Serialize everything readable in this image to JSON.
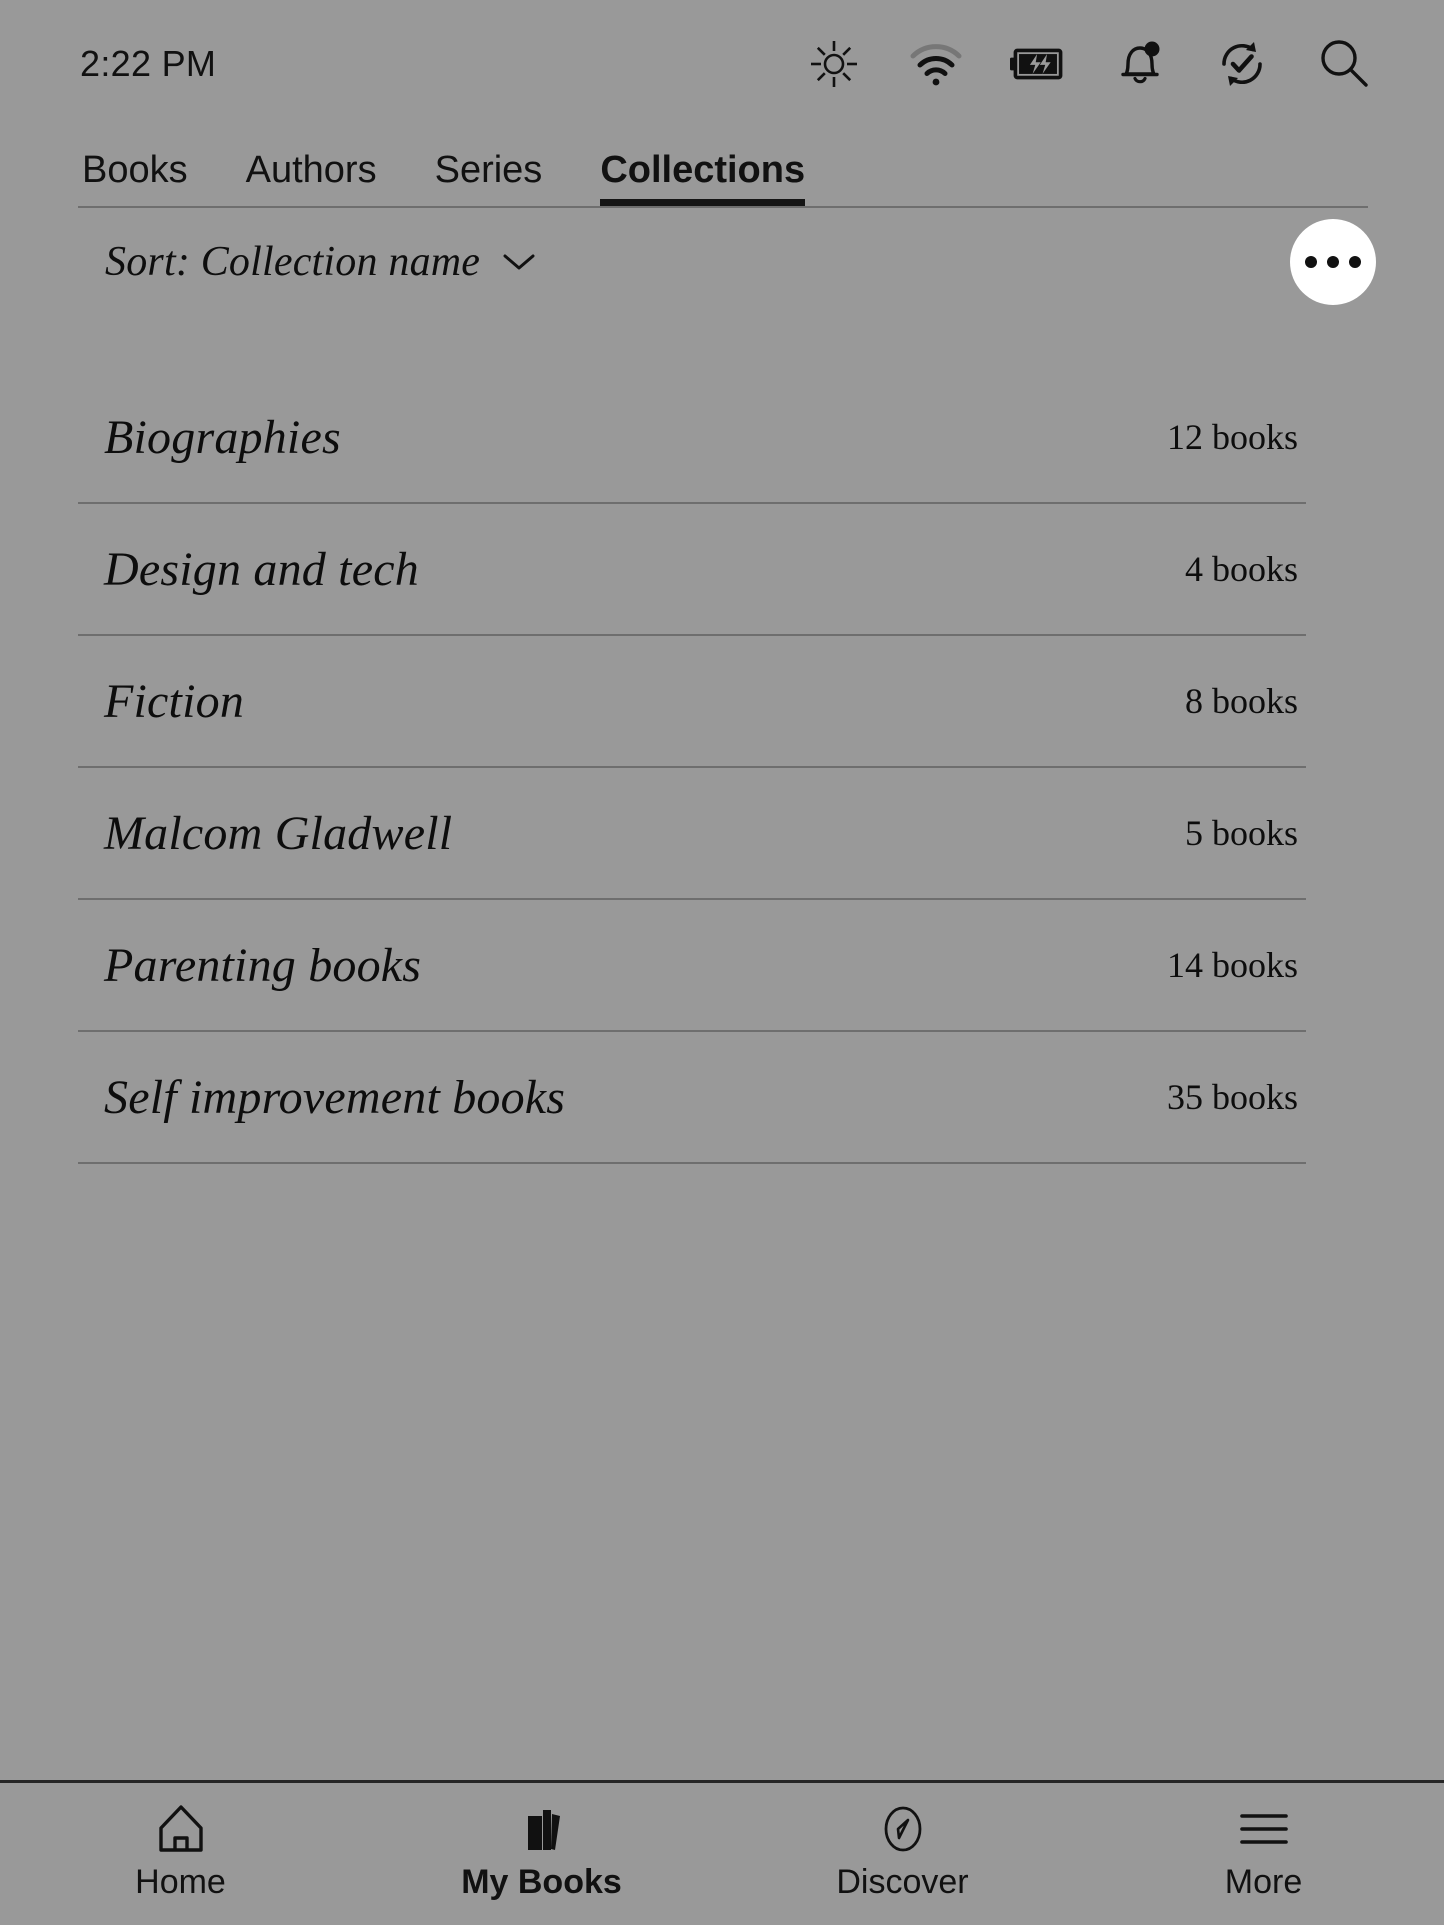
{
  "status_bar": {
    "time": "2:22 PM",
    "icons": [
      {
        "name": "brightness-icon",
        "label": "Brightness"
      },
      {
        "name": "wifi-icon",
        "label": "Wi-Fi"
      },
      {
        "name": "battery-charging-icon",
        "label": "Battery charging"
      },
      {
        "name": "notifications-bell-icon",
        "label": "Notifications"
      },
      {
        "name": "sync-icon",
        "label": "Sync"
      },
      {
        "name": "search-icon",
        "label": "Search"
      }
    ]
  },
  "tabs": [
    {
      "label": "Books",
      "active": false
    },
    {
      "label": "Authors",
      "active": false
    },
    {
      "label": "Series",
      "active": false
    },
    {
      "label": "Collections",
      "active": true
    }
  ],
  "sort": {
    "label": "Sort: Collection name",
    "chevron": "chevron-down-icon"
  },
  "overflow": {
    "label": "More options",
    "glyph": "ellipsis"
  },
  "collections": [
    {
      "name": "Biographies",
      "count": "12 books"
    },
    {
      "name": "Design and tech",
      "count": "4 books"
    },
    {
      "name": "Fiction",
      "count": "8 books"
    },
    {
      "name": "Malcom Gladwell",
      "count": "5 books"
    },
    {
      "name": "Parenting books",
      "count": "14 books"
    },
    {
      "name": "Self improvement books",
      "count": "35 books"
    }
  ],
  "bottom_nav": [
    {
      "label": "Home",
      "icon": "home-icon",
      "active": false
    },
    {
      "label": "My Books",
      "icon": "books-icon",
      "active": true
    },
    {
      "label": "Discover",
      "icon": "compass-icon",
      "active": false
    },
    {
      "label": "More",
      "icon": "hamburger-menu-icon",
      "active": false
    }
  ],
  "colors": {
    "background": "#999999",
    "text": "#111111",
    "divider": "#6e6e6e",
    "accent": "#151515",
    "button_bg": "#ffffff"
  }
}
